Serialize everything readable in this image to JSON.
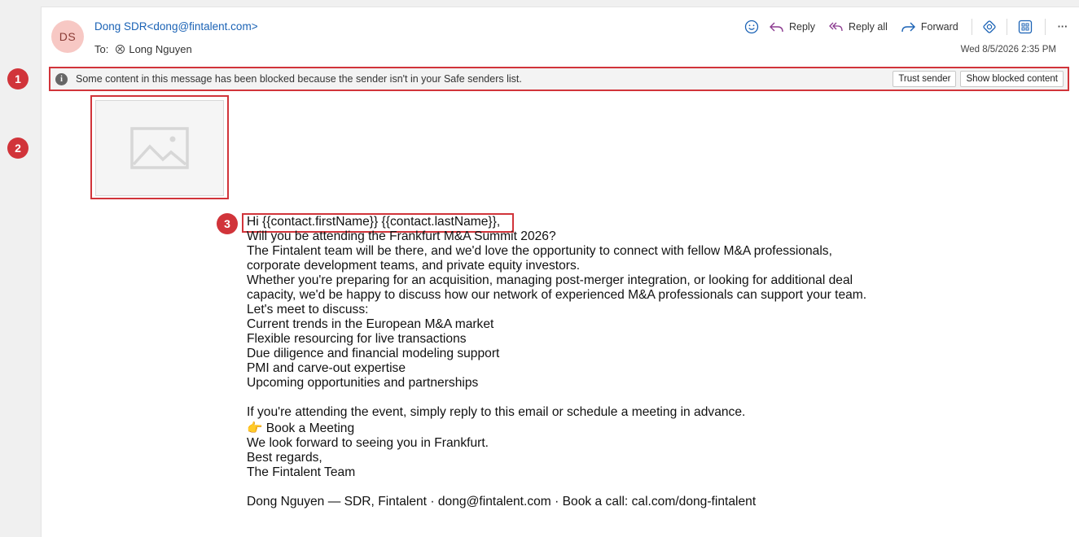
{
  "header": {
    "avatar_initials": "DS",
    "sender_name": "Dong SDR",
    "sender_email": "<dong@fintalent.com>",
    "to_label": "To:",
    "recipient": "Long Nguyen",
    "date": "Wed 8/5/2026 2:35 PM"
  },
  "toolbar": {
    "emoji_icon": "smiley-icon",
    "reply_label": "Reply",
    "reply_all_label": "Reply all",
    "forward_label": "Forward",
    "more_label": "···"
  },
  "banner": {
    "text": "Some content in this message has been blocked because the sender isn't in your Safe senders list.",
    "trust_label": "Trust sender",
    "show_label": "Show blocked content"
  },
  "badges": [
    "1",
    "2",
    "3"
  ],
  "body": {
    "greeting": "Hi {{contact.firstName}} {{contact.lastName}},",
    "lines": [
      "Will you be attending the Frankfurt M&A Summit 2026?",
      "The Fintalent team will be there, and we'd love the opportunity to connect with fellow M&A professionals,",
      "corporate development teams, and private equity investors.",
      "Whether you're preparing for an acquisition, managing post-merger integration, or looking for additional deal",
      "capacity, we'd be happy to discuss how our network of experienced M&A professionals can support your team.",
      "Let's meet to discuss:",
      "Current trends in the European M&A market",
      "Flexible resourcing for live transactions",
      "Due diligence and financial modeling support",
      "PMI and carve-out expertise",
      "Upcoming opportunities and partnerships"
    ],
    "cta_line": "If you're attending the event, simply reply to this email or schedule a meeting in advance.",
    "book_emoji": "👉",
    "book_label": "Book a Meeting",
    "closing": [
      "We look forward to seeing you in Frankfurt.",
      "Best regards,",
      "The Fintalent Team"
    ],
    "signature": "Dong Nguyen — SDR, Fintalent · dong@fintalent.com · Book a call: cal.com/dong-fintalent"
  },
  "colors": {
    "accent": "#1a62b5",
    "highlight": "#d1343a",
    "avatar_bg": "#f7c8c4"
  }
}
